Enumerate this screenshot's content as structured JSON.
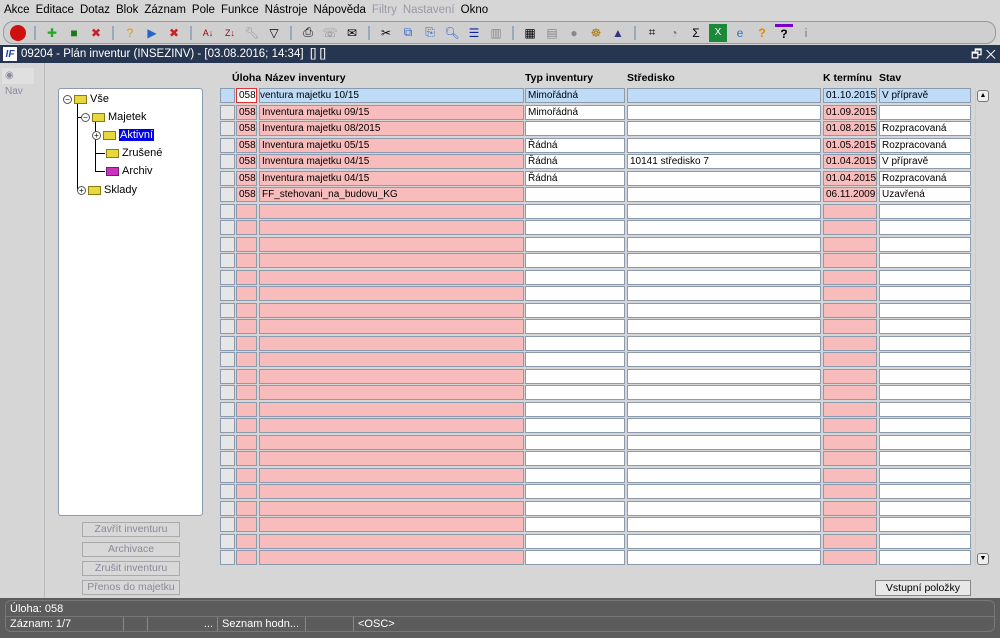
{
  "menu": [
    "Akce",
    "Editace",
    "Dotaz",
    "Blok",
    "Záznam",
    "Pole",
    "Funkce",
    "Nástroje",
    "Nápověda",
    "Filtry",
    "Nastavení",
    "Okno"
  ],
  "menu_disabled": [
    "Filtry",
    "Nastavení"
  ],
  "window": {
    "title": "09204 - Plán inventur (INSEZINV) - [03.08.2016; 14:34]  [] []",
    "logo": "IF"
  },
  "nav_label": "Nav",
  "tree": {
    "root": "Vše",
    "majetek": "Majetek",
    "aktivni": "Aktivní",
    "zrusene": "Zrušené",
    "archiv": "Archiv",
    "sklady": "Sklady"
  },
  "side_buttons": [
    "Zavřít inventuru",
    "Archivace",
    "Zrušit inventuru",
    "Přenos do majetku"
  ],
  "columns": {
    "uloha": "Úloha",
    "nazev": "Název inventury",
    "typ": "Typ inventury",
    "stredisko": "Středisko",
    "termin": "K termínu",
    "stav": "Stav"
  },
  "rows": [
    {
      "uloha": "058",
      "nazev": "ventura majetku 10/15",
      "typ": "Mimořádná",
      "stredisko": "",
      "termin": "01.10.2015",
      "stav": "V přípravě"
    },
    {
      "uloha": "058",
      "nazev": "Inventura majetku 09/15",
      "typ": "Mimořádná",
      "stredisko": "",
      "termin": "01.09.2015",
      "stav": ""
    },
    {
      "uloha": "058",
      "nazev": "Inventura majetku 08/2015",
      "typ": "",
      "stredisko": "",
      "termin": "01.08.2015",
      "stav": "Rozpracovaná"
    },
    {
      "uloha": "058",
      "nazev": "Inventura majetku 05/15",
      "typ": "Řádná",
      "stredisko": "",
      "termin": "01.05.2015",
      "stav": "Rozpracovaná"
    },
    {
      "uloha": "058",
      "nazev": "Inventura majetku 04/15",
      "typ": "Řádná",
      "stredisko": "10141 středisko 7",
      "termin": "01.04.2015",
      "stav": "V přípravě"
    },
    {
      "uloha": "058",
      "nazev": "Inventura majetku 04/15",
      "typ": "Řádná",
      "stredisko": "",
      "termin": "01.04.2015",
      "stav": "Rozpracovaná"
    },
    {
      "uloha": "058",
      "nazev": "FF_stehovani_na_budovu_KG",
      "typ": "",
      "stredisko": "",
      "termin": "06.11.2009",
      "stav": "Uzavřená"
    }
  ],
  "empty_rows": 22,
  "vstupni_button": "Vstupní položky",
  "status": {
    "line1": "Úloha: 058",
    "zaznam": "Záznam: 1/7",
    "dots": "...",
    "seznam": "Seznam hodn...",
    "osc": "<OSC>"
  },
  "colors": {
    "pink": "#f8bcbc",
    "selected": "#bedcf7",
    "title": "#273650"
  }
}
